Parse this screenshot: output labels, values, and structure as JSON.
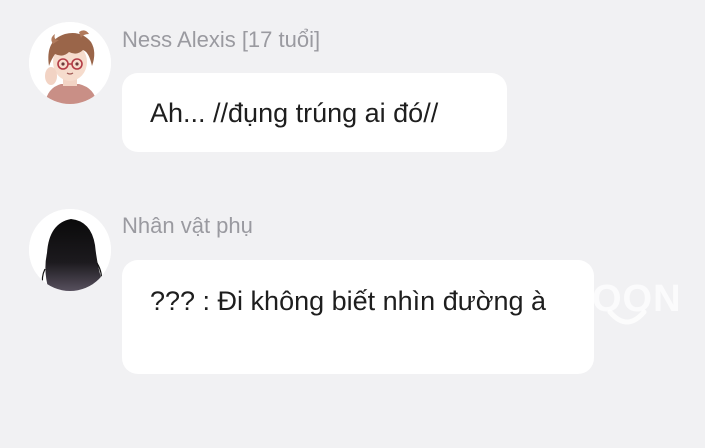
{
  "messages": [
    {
      "sender": "Ness Alexis [17 tuổi]",
      "text": "Ah... //đụng trúng ai đó//",
      "avatar_icon": "anime-boy-avatar"
    },
    {
      "sender": "Nhân vật phụ",
      "text": "??? : Đi không biết nhìn đường à",
      "avatar_icon": "silhouette-avatar"
    }
  ],
  "watermark": {
    "text": "OON"
  },
  "colors": {
    "background": "#f1f1f3",
    "bubble": "#ffffff",
    "sender_text": "#9a9aa0",
    "message_text": "#1e1e1e"
  }
}
